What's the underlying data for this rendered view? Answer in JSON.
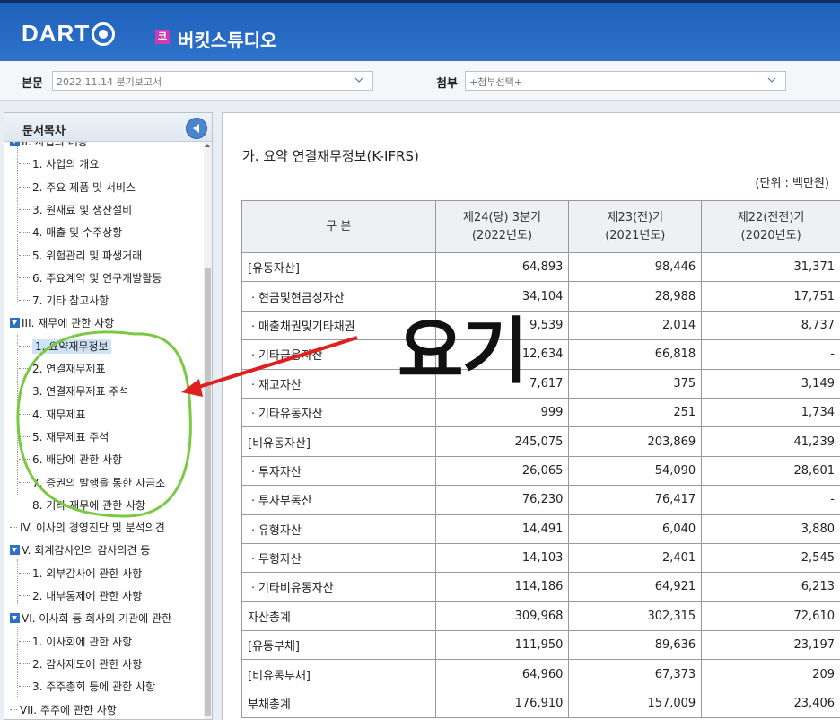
{
  "header": {
    "logo_text": "DART",
    "market_badge": "코",
    "company_name": "버킷스튜디오"
  },
  "toolbar": {
    "main_label": "본문",
    "main_value": "2022.11.14  분기보고서",
    "attach_label": "첨부",
    "attach_value": "+첨부선택+"
  },
  "sidebar": {
    "title": "문서목차",
    "items": [
      {
        "label": "II. 사업의 내용",
        "level": 0,
        "toggle": true
      },
      {
        "label": "1. 사업의 개요",
        "level": 1
      },
      {
        "label": "2. 주요 제품 및 서비스",
        "level": 1
      },
      {
        "label": "3. 원재료 및 생산설비",
        "level": 1
      },
      {
        "label": "4. 매출 및 수주상황",
        "level": 1
      },
      {
        "label": "5. 위험관리 및 파생거래",
        "level": 1
      },
      {
        "label": "6. 주요계약 및 연구개발활동",
        "level": 1
      },
      {
        "label": "7. 기타 참고사항",
        "level": 1
      },
      {
        "label": "III. 재무에 관한 사항",
        "level": 0,
        "toggle": true
      },
      {
        "label": "1. 요약재무정보",
        "level": 1,
        "selected": true
      },
      {
        "label": "2. 연결재무제표",
        "level": 1
      },
      {
        "label": "3. 연결재무제표 주석",
        "level": 1
      },
      {
        "label": "4. 재무제표",
        "level": 1
      },
      {
        "label": "5. 재무제표 주석",
        "level": 1
      },
      {
        "label": "6. 배당에 관한 사항",
        "level": 1
      },
      {
        "label": "7. 증권의 발행을 통한 자금조",
        "level": 1
      },
      {
        "label": "8. 기타 재무에 관한 사항",
        "level": 1
      },
      {
        "label": "IV. 이사의 경영진단 및 분석의견",
        "level": 0
      },
      {
        "label": "V. 회계감사인의 감사의견 등",
        "level": 0,
        "toggle": true
      },
      {
        "label": "1. 외부감사에 관한 사항",
        "level": 1
      },
      {
        "label": "2. 내부통제에 관한 사항",
        "level": 1
      },
      {
        "label": "VI. 이사회 등 회사의 기관에 관한",
        "level": 0,
        "toggle": true
      },
      {
        "label": "1. 이사회에 관한 사항",
        "level": 1
      },
      {
        "label": "2. 감사제도에 관한 사항",
        "level": 1
      },
      {
        "label": "3. 주주총회 등에 관한 사항",
        "level": 1
      },
      {
        "label": "VII. 주주에 관한 사항",
        "level": 0
      }
    ]
  },
  "content": {
    "section_title": "가. 요약 연결재무정보(K-IFRS)",
    "unit": "(단위 : 백만원)",
    "table": {
      "headers": [
        {
          "line1": "구 분",
          "line2": ""
        },
        {
          "line1": "제24(당) 3분기",
          "line2": "(2022년도)"
        },
        {
          "line1": "제23(전)기",
          "line2": "(2021년도)"
        },
        {
          "line1": "제22(전전)기",
          "line2": "(2020년도)"
        }
      ],
      "rows": [
        [
          "[유동자산]",
          "64,893",
          "98,446",
          "31,371"
        ],
        [
          "ㆍ현금및현금성자산",
          "34,104",
          "28,988",
          "17,751"
        ],
        [
          "ㆍ매출채권및기타채권",
          "9,539",
          "2,014",
          "8,737"
        ],
        [
          "ㆍ기타금융자산",
          "12,634",
          "66,818",
          "-"
        ],
        [
          "ㆍ재고자산",
          "7,617",
          "375",
          "3,149"
        ],
        [
          "ㆍ기타유동자산",
          "999",
          "251",
          "1,734"
        ],
        [
          "[비유동자산]",
          "245,075",
          "203,869",
          "41,239"
        ],
        [
          "ㆍ투자자산",
          "26,065",
          "54,090",
          "28,601"
        ],
        [
          "ㆍ투자부동산",
          "76,230",
          "76,417",
          "-"
        ],
        [
          "ㆍ유형자산",
          "14,491",
          "6,040",
          "3,880"
        ],
        [
          "ㆍ무형자산",
          "14,103",
          "2,401",
          "2,545"
        ],
        [
          "ㆍ기타비유동자산",
          "114,186",
          "64,921",
          "6,213"
        ],
        [
          "자산총계",
          "309,968",
          "302,315",
          "72,610"
        ],
        [
          "[유동부채]",
          "111,950",
          "89,636",
          "23,197"
        ],
        [
          "[비유동부채]",
          "64,960",
          "67,373",
          "209"
        ],
        [
          "부채총계",
          "176,910",
          "157,009",
          "23,406"
        ]
      ]
    }
  },
  "annotation": {
    "text": "요기",
    "arrow_color": "#e02020",
    "circle_color": "#7ac943"
  }
}
